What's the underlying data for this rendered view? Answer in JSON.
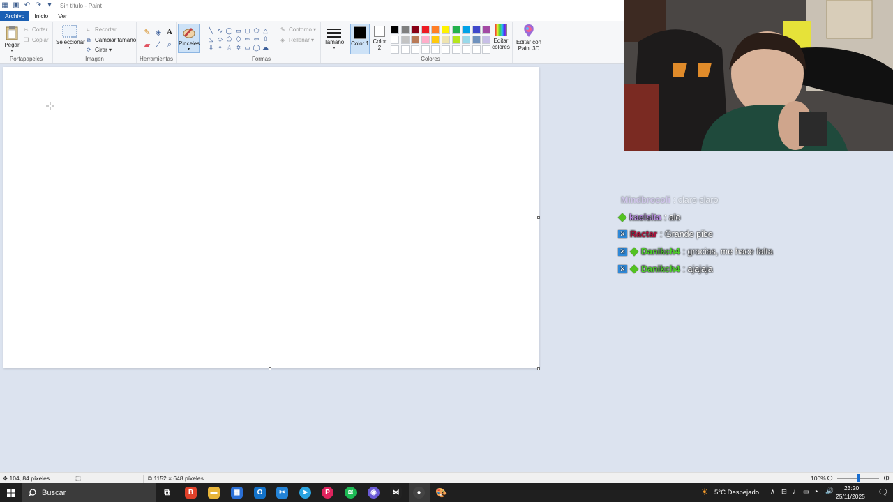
{
  "window": {
    "title": "Sin título - Paint",
    "tabs": [
      "Archivo",
      "Inicio",
      "Ver"
    ]
  },
  "ribbon": {
    "portapapeles": {
      "label": "Portapapeles",
      "pegar": "Pegar",
      "cortar": "Cortar",
      "copiar": "Copiar"
    },
    "imagen": {
      "label": "Imagen",
      "seleccionar": "Seleccionar",
      "recortar": "Recortar",
      "cambiar_tamano": "Cambiar tamaño",
      "girar": "Girar"
    },
    "herramientas": {
      "label": "Herramientas"
    },
    "pinceles": "Pinceles",
    "formas": {
      "label": "Formas",
      "contorno": "Contorno",
      "rellenar": "Rellenar"
    },
    "tamano": "Tamaño",
    "color1": "Color 1",
    "color2": "Color 2",
    "colores": {
      "label": "Colores"
    },
    "editar_colores": "Editar colores",
    "editar_paint3d": "Editar con Paint 3D"
  },
  "palette": {
    "row1": [
      "#000000",
      "#7f7f7f",
      "#880015",
      "#ed1c24",
      "#ff7f27",
      "#fff200",
      "#22b14c",
      "#00a2e8",
      "#3f48cc",
      "#a349a4"
    ],
    "row2": [
      "#ffffff",
      "#c3c3c3",
      "#b97a57",
      "#ffaec9",
      "#ffc90e",
      "#efe4b0",
      "#b5e61d",
      "#99d9ea",
      "#7092be",
      "#c8bfe7"
    ],
    "row3": [
      "#ffffff",
      "#ffffff",
      "#ffffff",
      "#ffffff",
      "#ffffff",
      "#ffffff",
      "#ffffff",
      "#ffffff",
      "#ffffff",
      "#ffffff"
    ]
  },
  "chat": {
    "faded": {
      "user": "Mindbrocoli",
      "text": ": claro claro"
    },
    "messages": [
      {
        "user": "kaelsita",
        "text": ": alo",
        "user_color": "#b98ee0",
        "badges": [
          "diamond"
        ]
      },
      {
        "user": "Ractar",
        "text": ": Grande pibe",
        "user_color": "#b3103c",
        "badges": [
          "square"
        ]
      },
      {
        "user": "Danikch4",
        "text": ": gracias, me hace falta",
        "user_color": "#4fd12c",
        "badges": [
          "square",
          "diamond"
        ]
      },
      {
        "user": "Danikch4",
        "text": ": ajajaja",
        "user_color": "#4fd12c",
        "badges": [
          "square",
          "diamond"
        ]
      }
    ]
  },
  "status": {
    "cursor_pos": "104, 84 píxeles",
    "canvas_size": "1152 × 648 píxeles",
    "zoom": "100%"
  },
  "taskbar": {
    "search": "Buscar",
    "weather": "5°C  Despejado",
    "time": "23:20",
    "date": "25/11/2025"
  }
}
